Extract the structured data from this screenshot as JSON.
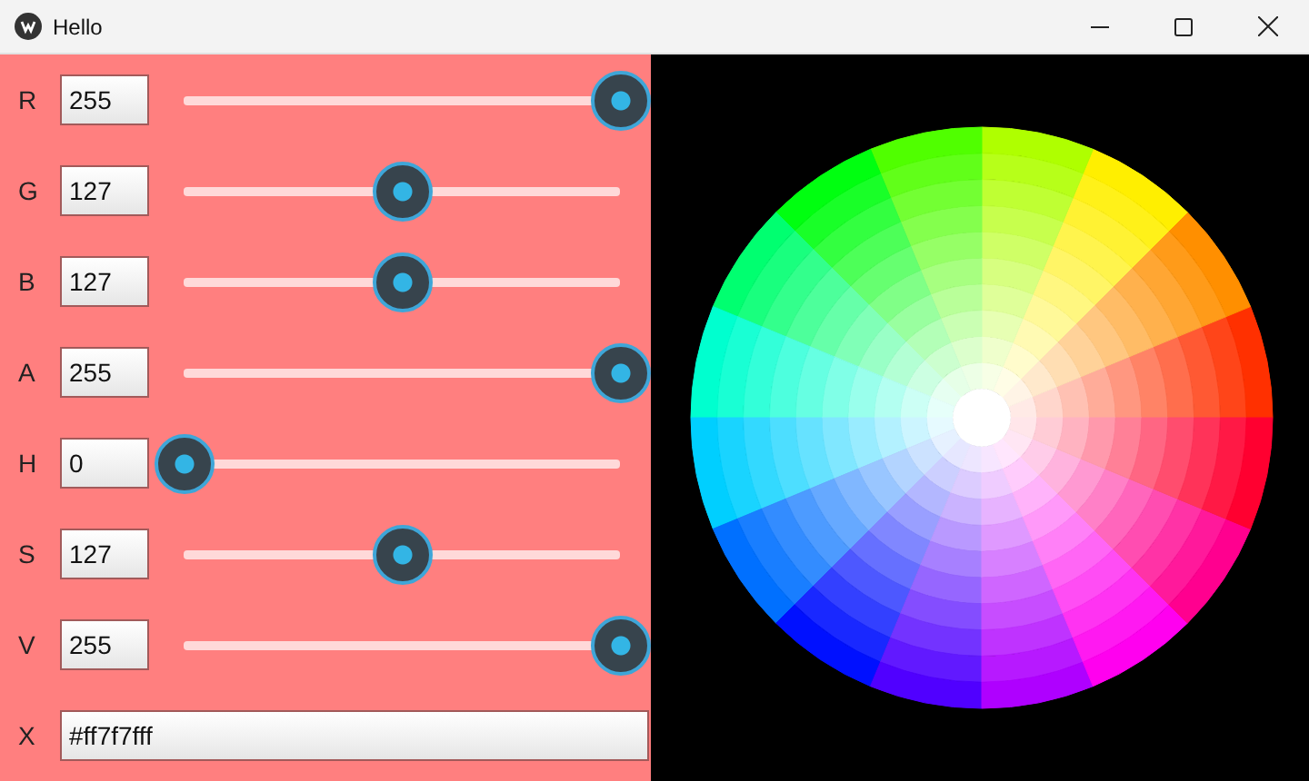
{
  "window": {
    "title": "Hello"
  },
  "channels": [
    {
      "label": "R",
      "value": "255",
      "level": 1
    },
    {
      "label": "G",
      "value": "127",
      "level": 0.5
    },
    {
      "label": "B",
      "value": "127",
      "level": 0.5
    },
    {
      "label": "A",
      "value": "255",
      "level": 1
    },
    {
      "label": "H",
      "value": "0",
      "level": 0
    },
    {
      "label": "S",
      "value": "127",
      "level": 0.5
    },
    {
      "label": "V",
      "value": "255",
      "level": 1
    }
  ],
  "hex": {
    "label": "X",
    "value": "#ff7f7fff"
  }
}
